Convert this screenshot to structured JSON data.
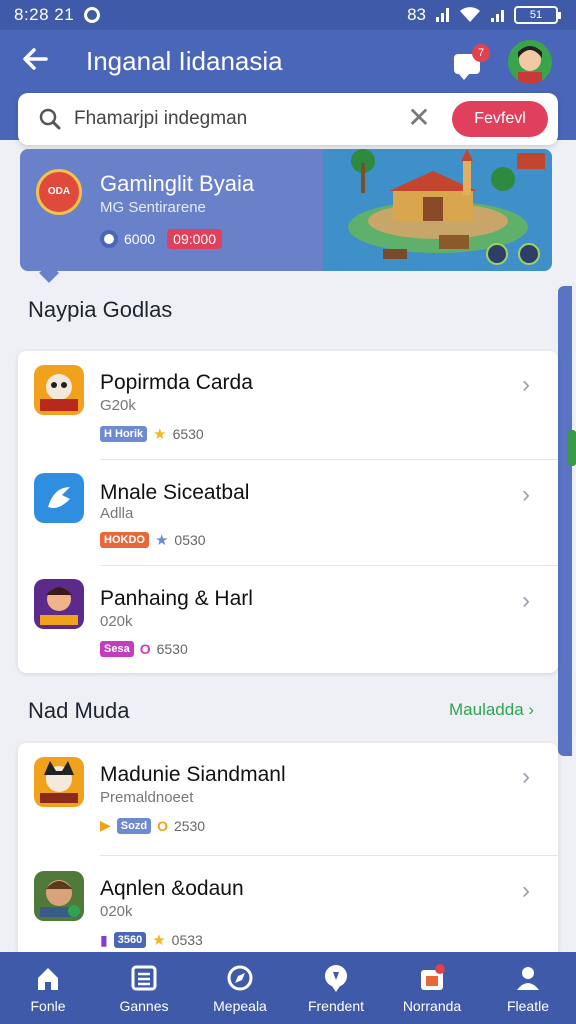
{
  "status_bar": {
    "time": "8:28 21",
    "right_text": "83",
    "battery": "51"
  },
  "header": {
    "title": "Inganal Iidanasia",
    "notification_count": "7"
  },
  "search": {
    "placeholder": "Fhamarjpi indegman",
    "value": "Fhamarjpi indegman",
    "button_label": "Fevfevl"
  },
  "banner": {
    "title": "Gaminglit Byaia",
    "subtitle": "MG Sentirarene",
    "logo_text": "ODA",
    "stat_value": "6000",
    "stat_badge": "09:000"
  },
  "sections": [
    {
      "title": "Naypia Godlas",
      "items": [
        {
          "title": "Popirmda Carda",
          "subtitle": "G20k",
          "tag": "H Horik",
          "rating": "6530",
          "rating_icon": "star"
        },
        {
          "title": "Mnale Siceatbal",
          "subtitle": "Adlla",
          "tag": "HOKDO",
          "rating": "0530",
          "rating_icon": "star"
        },
        {
          "title": "Panhaing & Harl",
          "subtitle": "020k",
          "tag": "Sesa",
          "rating": "6530",
          "rating_icon": "coin"
        }
      ]
    },
    {
      "title": "Nad Muda",
      "see_all": "Mauladda",
      "items": [
        {
          "title": "Madunie Siandmanl",
          "subtitle": "Premaldnoeet",
          "tag": "Sozd",
          "rating": "2530",
          "rating_icon": "coin"
        },
        {
          "title": "Aqnlen &odaun",
          "subtitle": "020k",
          "tag": "3560",
          "rating": "0533",
          "rating_icon": "star"
        }
      ]
    }
  ],
  "bottom_nav": [
    {
      "label": "Fonle",
      "icon": "home-icon"
    },
    {
      "label": "Gannes",
      "icon": "games-icon"
    },
    {
      "label": "Mepeala",
      "icon": "compass-icon"
    },
    {
      "label": "Frendent",
      "icon": "pin-icon"
    },
    {
      "label": "Norranda",
      "icon": "inbox-icon"
    },
    {
      "label": "Fleatle",
      "icon": "profile-icon"
    }
  ],
  "colors": {
    "primary": "#4a66b8",
    "accent": "#e0405c",
    "success": "#2fa352"
  }
}
